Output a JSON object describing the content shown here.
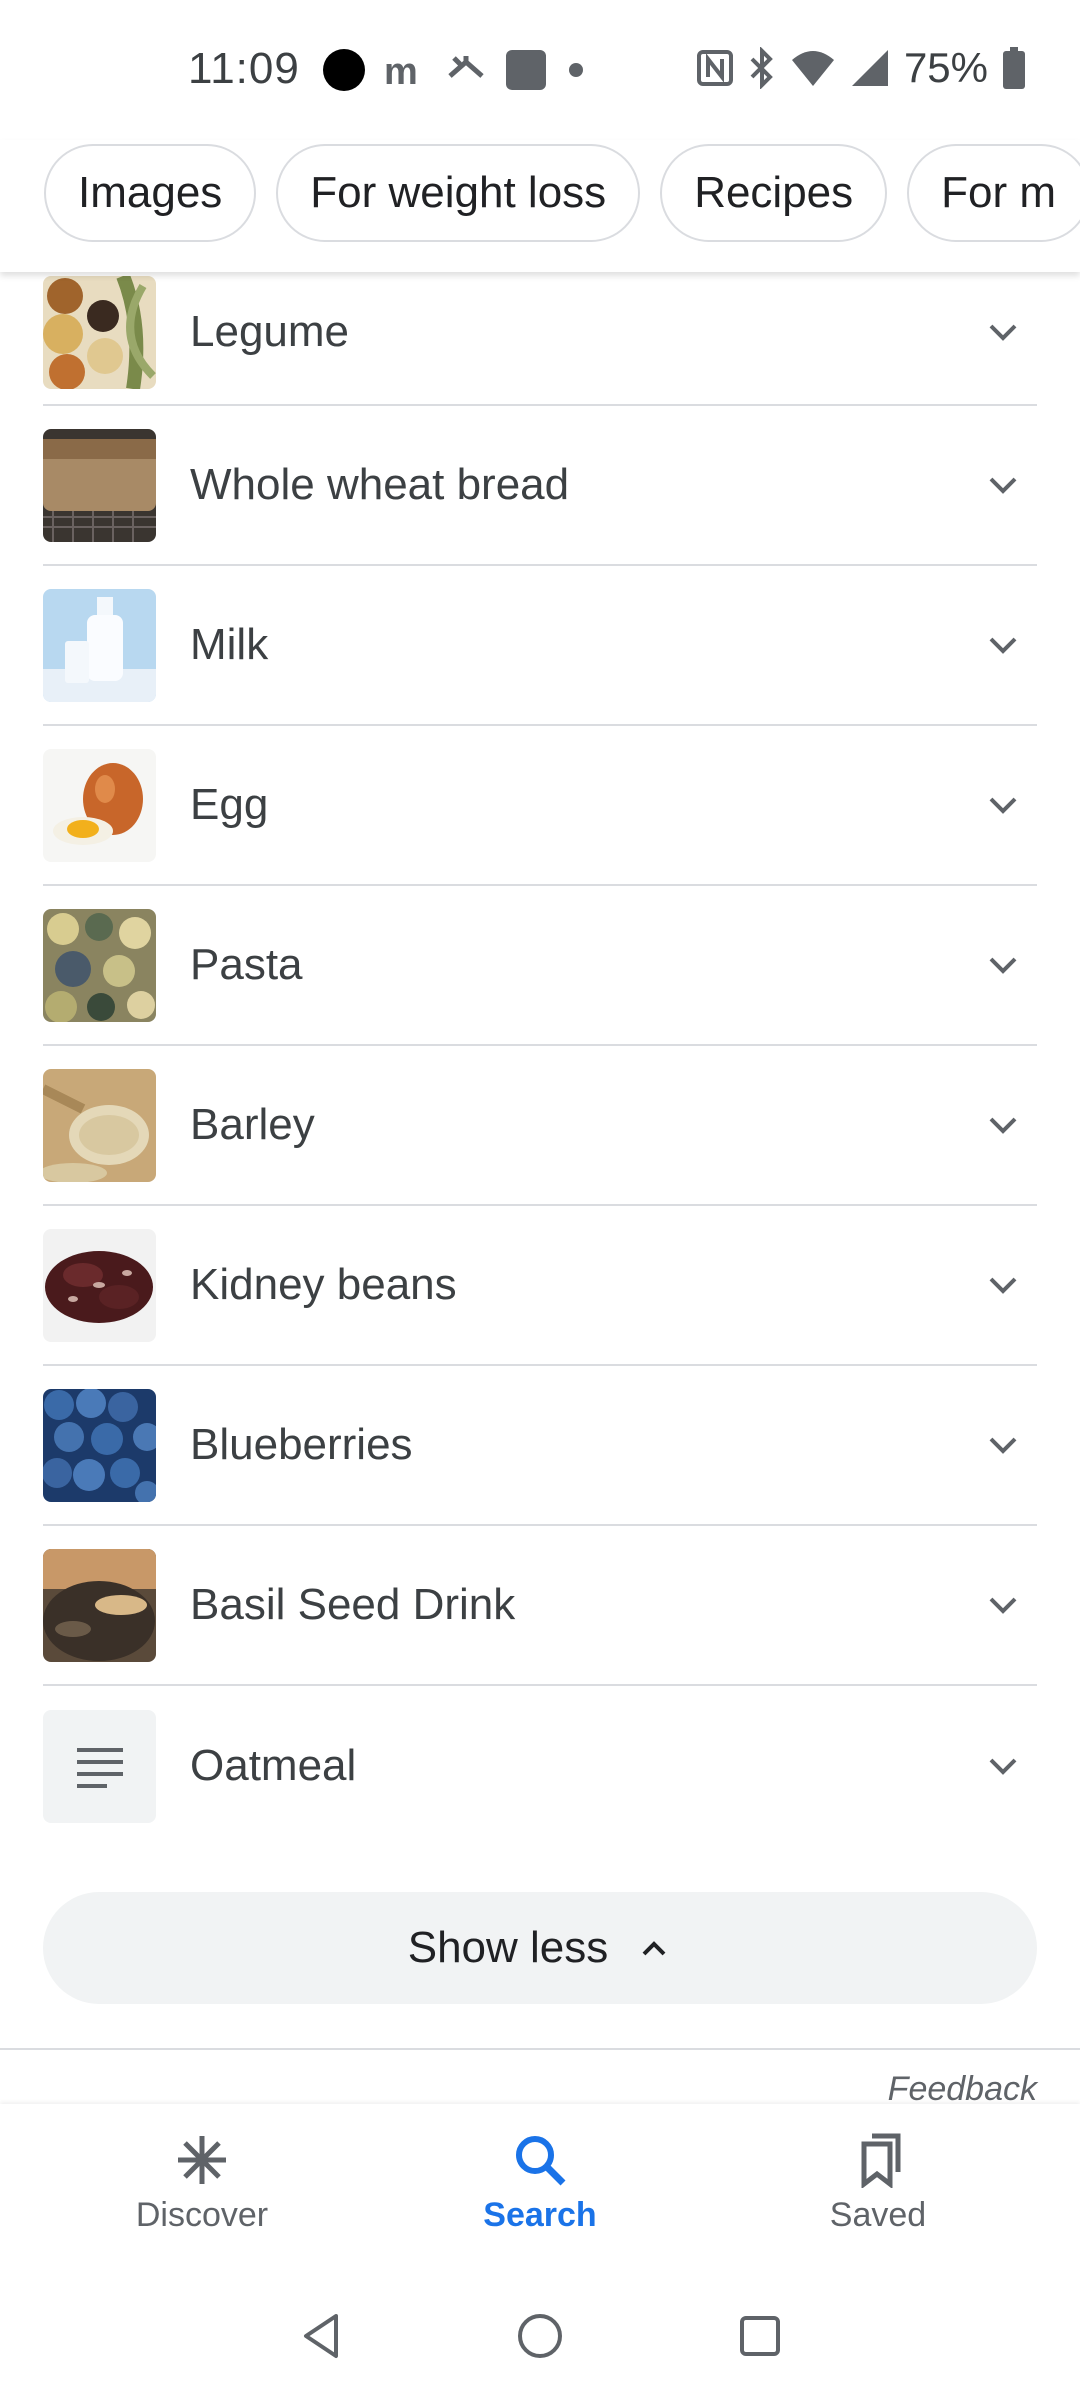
{
  "status_bar": {
    "time": "11:09",
    "battery_percent": "75%",
    "icons": [
      "record-dot-icon",
      "m-app-icon",
      "missed-call-icon",
      "app-square-icon",
      "notification-dot-icon",
      "nfc-icon",
      "bluetooth-icon",
      "wifi-icon",
      "signal-icon",
      "battery-icon"
    ]
  },
  "chips": [
    {
      "label": "Images"
    },
    {
      "label": "For weight loss"
    },
    {
      "label": "Recipes"
    },
    {
      "label": "For m"
    }
  ],
  "list_items": [
    {
      "label": "Legume",
      "thumb": "legume"
    },
    {
      "label": "Whole wheat bread",
      "thumb": "bread"
    },
    {
      "label": "Milk",
      "thumb": "milk"
    },
    {
      "label": "Egg",
      "thumb": "egg"
    },
    {
      "label": "Pasta",
      "thumb": "pasta"
    },
    {
      "label": "Barley",
      "thumb": "barley"
    },
    {
      "label": "Kidney beans",
      "thumb": "kidney-beans"
    },
    {
      "label": "Blueberries",
      "thumb": "blueberries"
    },
    {
      "label": "Basil Seed Drink",
      "thumb": "basil-seed"
    },
    {
      "label": "Oatmeal",
      "thumb": "text-doc"
    }
  ],
  "show_less": {
    "label": "Show less"
  },
  "feedback": {
    "label": "Feedback"
  },
  "bottom_nav": [
    {
      "label": "Discover",
      "icon": "asterisk-icon",
      "active": false
    },
    {
      "label": "Search",
      "icon": "search-icon",
      "active": true
    },
    {
      "label": "Saved",
      "icon": "bookmarks-icon",
      "active": false
    }
  ],
  "colors": {
    "accent": "#1a73e8",
    "text": "#3c4043",
    "divider": "#dadce0",
    "button_bg": "#f1f3f4"
  }
}
